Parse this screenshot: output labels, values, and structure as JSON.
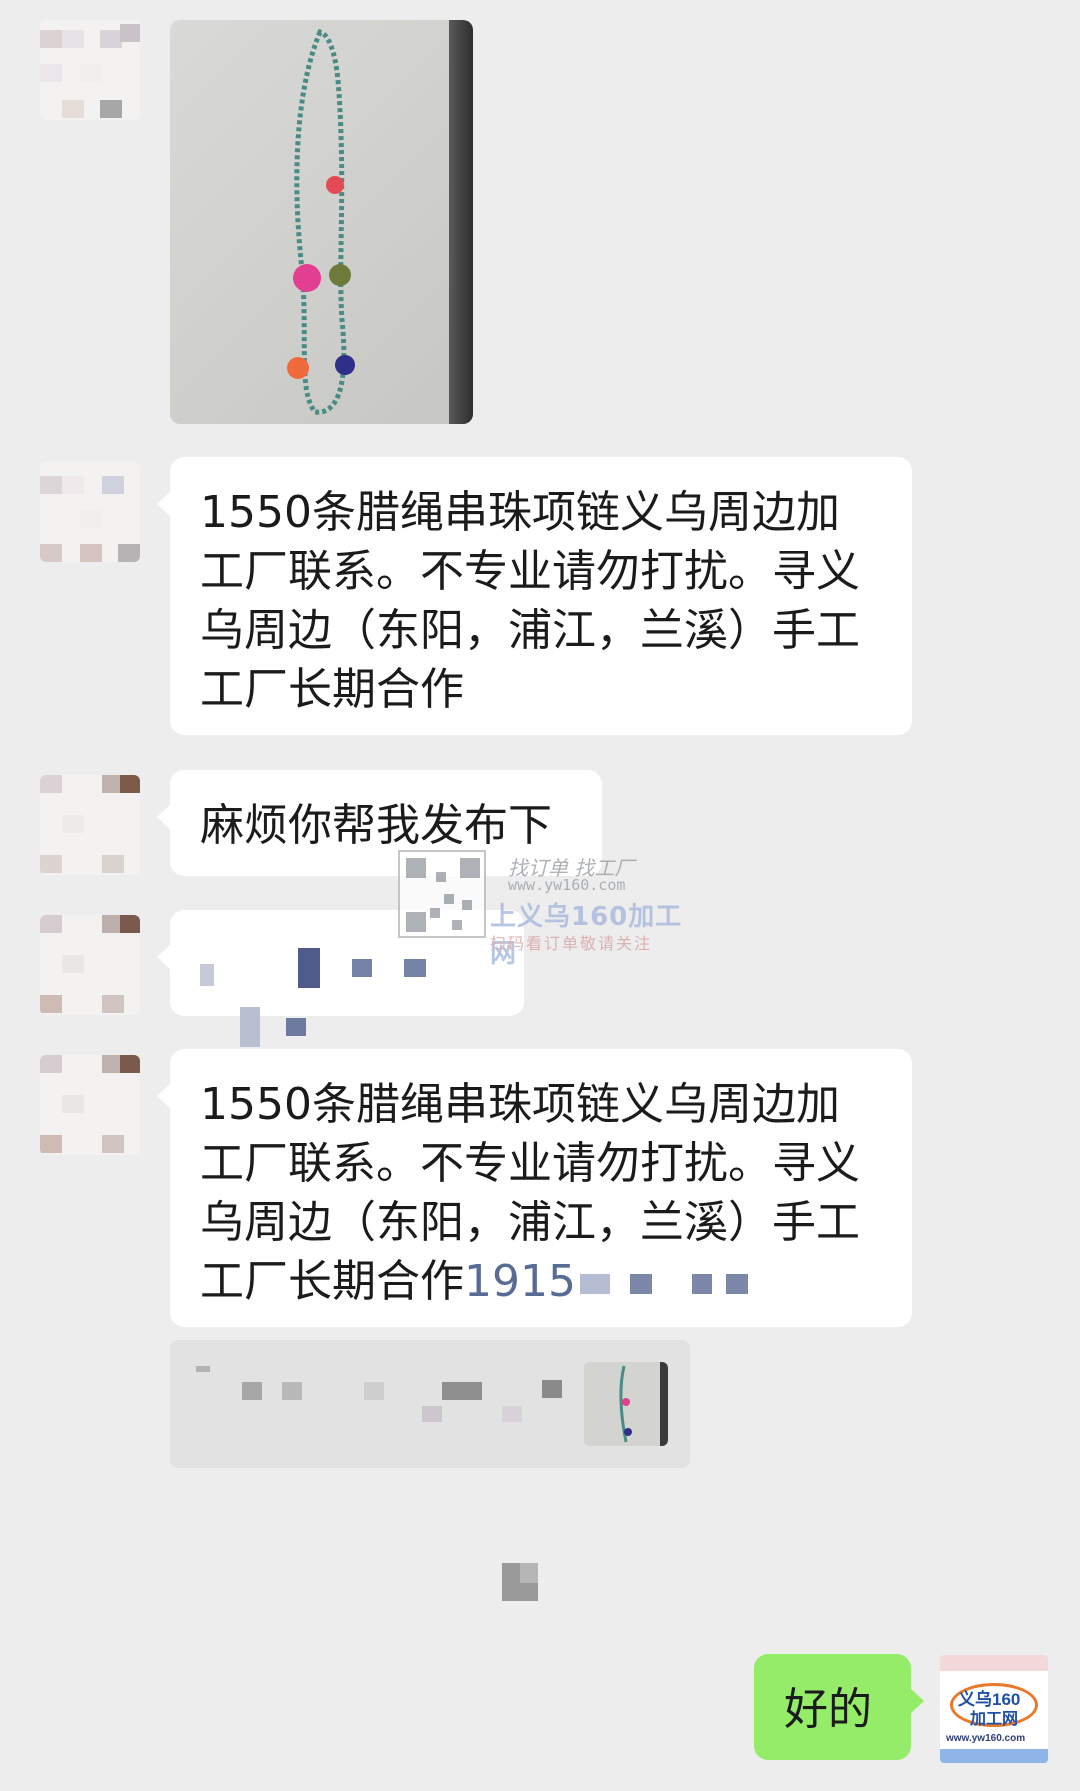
{
  "messages": {
    "long_text_1": "1550条腊绳串珠项链义乌周边加工厂联系。不专业请勿打扰。寻义乌周边（东阳，浦江，兰溪）手工工厂长期合作",
    "short_text": "麻烦你帮我发布下",
    "long_text_2": "1550条腊绳串珠项链义乌周边加工厂联系。不专业请勿打扰。寻义乌周边（东阳，浦江，兰溪）手工工厂长期合作",
    "phone_partial": "1915",
    "reply": "好的"
  },
  "watermark": {
    "line1": "找订单 找工厂",
    "url": "www.yw160.com",
    "brand": "上义乌160加工网",
    "sub": "扫码看订单敬请关注"
  },
  "my_avatar": {
    "line1": "义乌160",
    "line2": "加工网",
    "url": "www.yw160.com"
  },
  "colors": {
    "background": "#ededed",
    "bubble_in": "#ffffff",
    "bubble_out": "#95ec69",
    "link": "#576b95"
  },
  "icons": [
    "avatar-pixelated",
    "necklace-photo",
    "qr-code",
    "yw160-logo"
  ]
}
